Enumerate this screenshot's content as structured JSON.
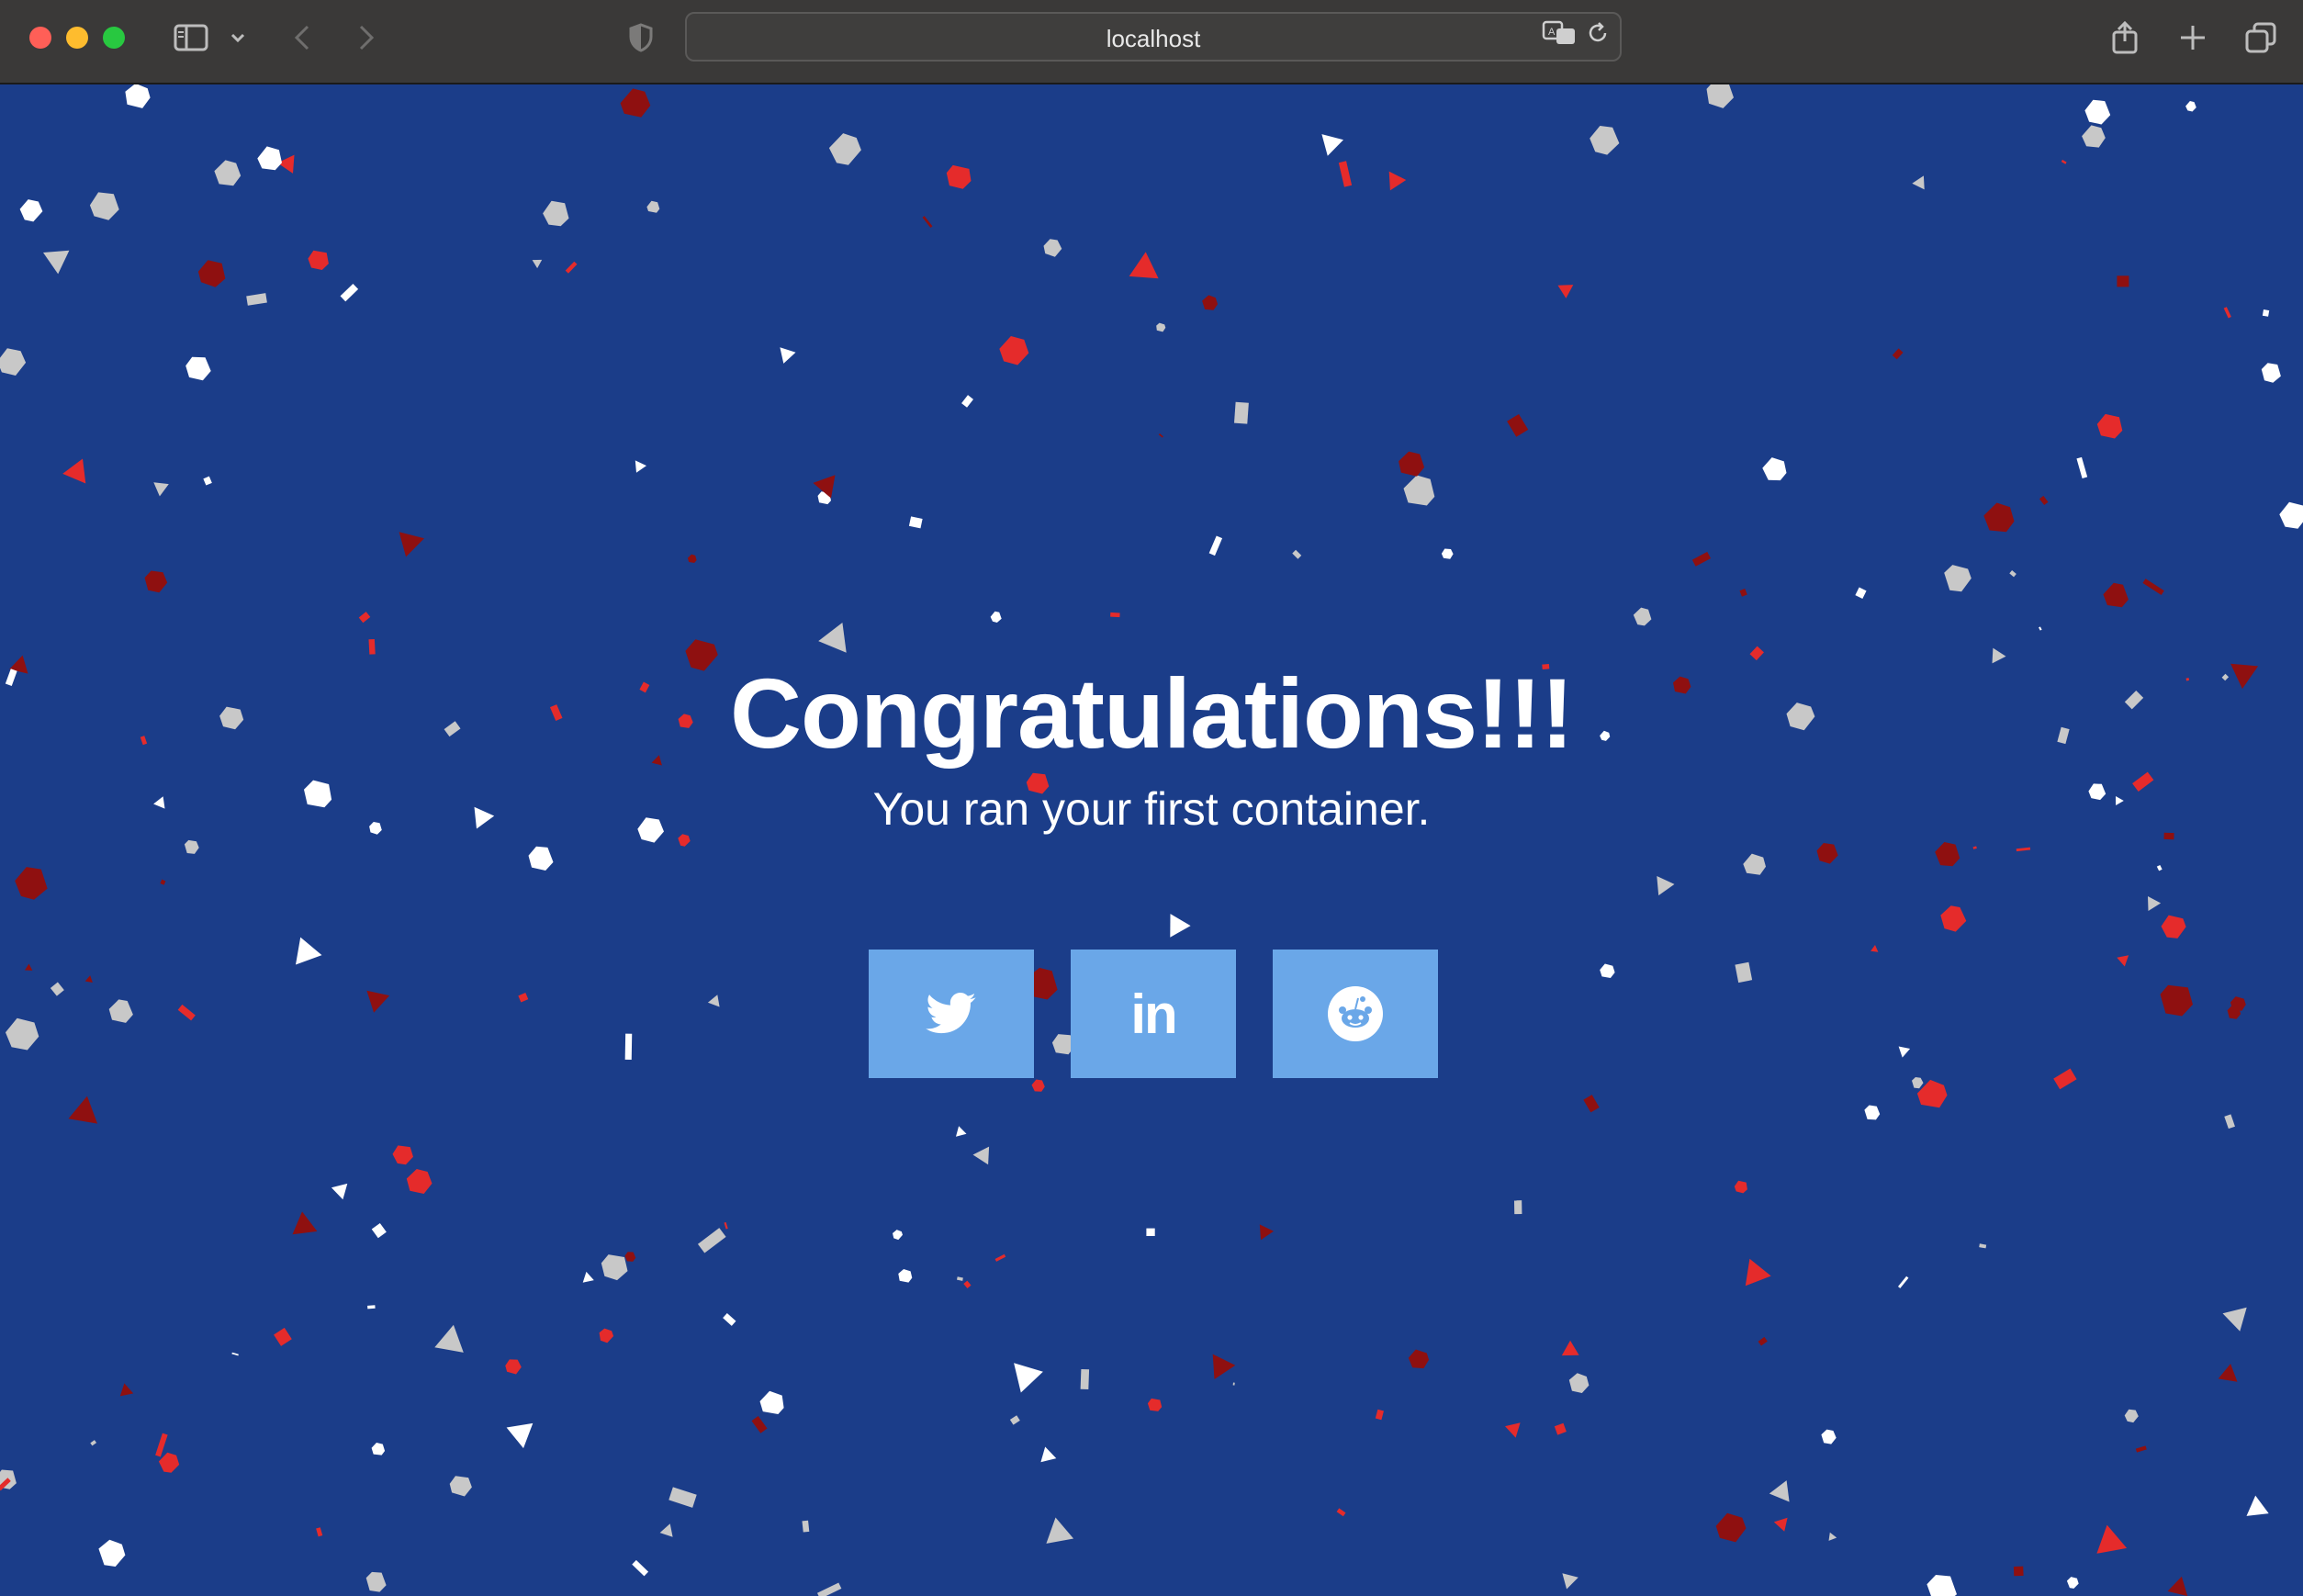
{
  "browser": {
    "url": "localhost",
    "icons": [
      "sidebar-icon",
      "chevron-down-icon",
      "back-icon",
      "forward-icon",
      "shield-icon",
      "translate-icon",
      "reload-icon",
      "share-icon",
      "new-tab-icon",
      "tab-overview-icon"
    ]
  },
  "page": {
    "headline": "Congratulations!!!",
    "subline": "You ran your first container.",
    "share_buttons": [
      {
        "network": "Twitter",
        "icon": "twitter-icon"
      },
      {
        "network": "LinkedIn",
        "icon": "linkedin-icon",
        "glyph": "in"
      },
      {
        "network": "Reddit",
        "icon": "reddit-icon"
      }
    ],
    "colors": {
      "background": "#1b3d89",
      "button": "#6aa7e8",
      "confetti": [
        "#ffffff",
        "#c8c8c8",
        "#e52b2b",
        "#8f1010"
      ]
    }
  }
}
